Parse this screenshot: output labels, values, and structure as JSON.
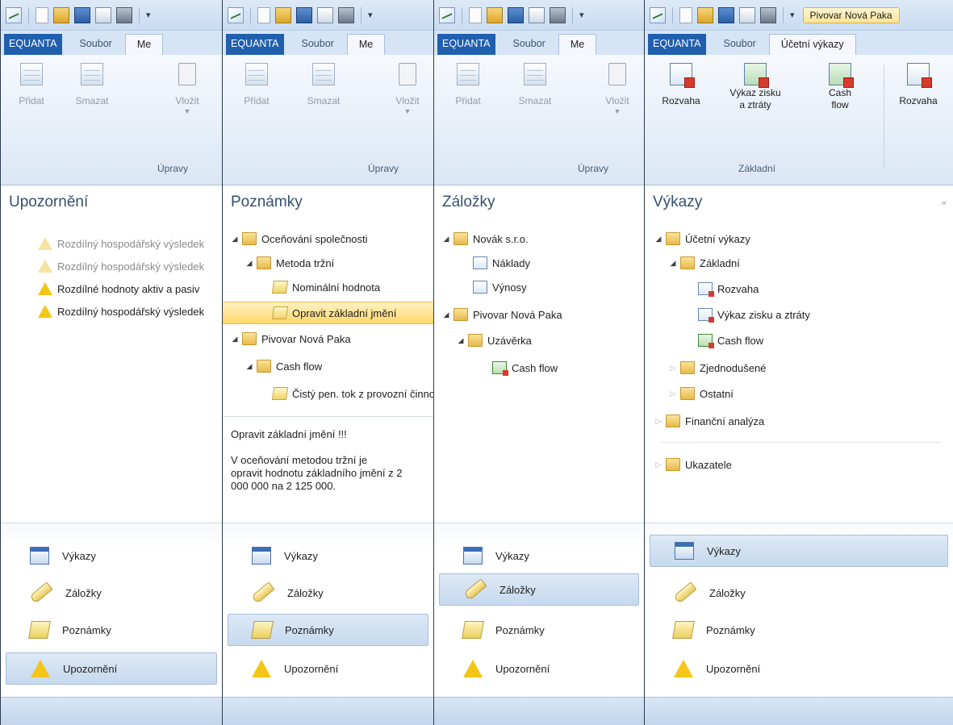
{
  "common": {
    "app_tab": "EQUANTA",
    "file_tab": "Soubor",
    "nav": {
      "vykazy": "Výkazy",
      "zalozky": "Záložky",
      "poznamky": "Poznámky",
      "upozorneni": "Upozornění"
    },
    "quick_access_dropdown": "▾"
  },
  "panel1": {
    "partial_tab": "Me",
    "ribbon": {
      "add": "Přidat",
      "delete": "Smazat",
      "paste": "Vložit",
      "group": "Úpravy"
    },
    "title": "Upozornění",
    "warnings": [
      "Rozdílný hospodářský výsledek",
      "Rozdílný hospodářský výsledek",
      "Rozdílné hodnoty aktiv a pasiv",
      "Rozdílný hospodářský výsledek"
    ],
    "active_nav": "upozorneni"
  },
  "panel2": {
    "partial_tab": "Me",
    "ribbon": {
      "add": "Přidat",
      "delete": "Smazat",
      "paste": "Vložit",
      "group": "Úpravy"
    },
    "title": "Poznámky",
    "tree": [
      "Oceňování společnosti",
      "Metoda tržní",
      "Nominální hodnota",
      "Opravit základní jmění",
      "Pivovar Nová Paka",
      "Cash flow",
      "Čistý pen. tok z provozní činnosti"
    ],
    "note_title": "Opravit základní jmění !!!",
    "note_lines": [
      "V oceňování metodou tržní je",
      "opravit hodnotu základního jmění z 2",
      "000 000 na 2 125 000."
    ],
    "active_nav": "poznamky"
  },
  "panel3": {
    "partial_tab": "Me",
    "ribbon": {
      "add": "Přidat",
      "delete": "Smazat",
      "paste": "Vložit",
      "group": "Úpravy"
    },
    "title": "Záložky",
    "tree": [
      "Novák s.r.o.",
      "Náklady",
      "Výnosy",
      "Pivovar Nová Paka",
      "Uzávěrka",
      "Cash flow"
    ],
    "active_nav": "zalozky"
  },
  "panel4": {
    "document_title": "Pivovar Nová Paka",
    "active_tab": "Účetní výkazy",
    "ribbon": {
      "rozvaha": "Rozvaha",
      "vzz_line1": "Výkaz zisku",
      "vzz_line2": "a ztráty",
      "cf_line1": "Cash",
      "cf_line2": "flow",
      "rozvaha2": "Rozvaha",
      "group": "Základní"
    },
    "title": "Výkazy",
    "collapse_glyph": "«",
    "tree": [
      "Účetní výkazy",
      "Základní",
      "Rozvaha",
      "Výkaz zisku a ztráty",
      "Cash flow",
      "Zjednodušené",
      "Ostatní",
      "Finanční analýza",
      "Ukazatele"
    ],
    "active_nav": "vykazy"
  },
  "colors": {
    "accent": "#1f5fae",
    "ribbon_bg": "#dbe7f5",
    "selection": "#ffd86a",
    "warning": "#f5c518"
  }
}
